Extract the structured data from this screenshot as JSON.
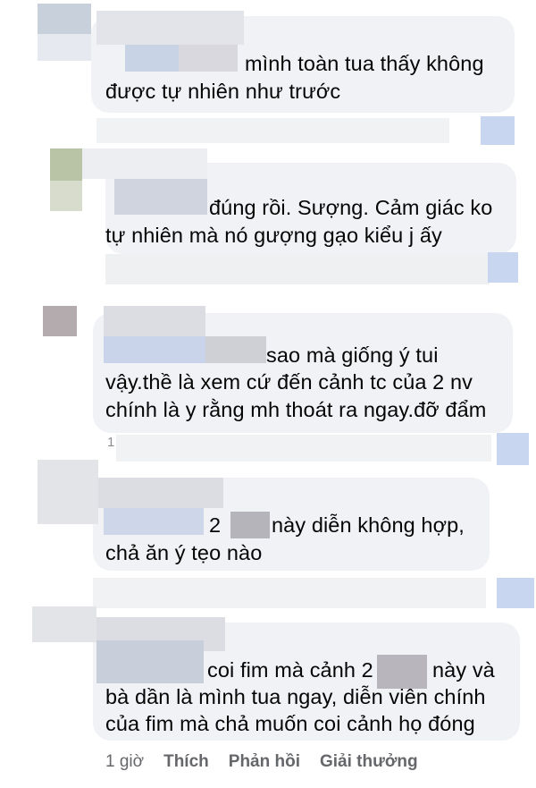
{
  "comments": [
    {
      "lines": [
        "mình toàn tua thấy không",
        "được tự nhiên như trước"
      ]
    },
    {
      "lines": [
        "đúng rồi. Sượng. Cảm giác ko",
        "tự nhiên mà nó gượng gạo kiểu j ấy"
      ]
    },
    {
      "lines": [
        "sao mà giống ý tui",
        "vậy.thề là xem cứ đến cảnh tc của 2 nv",
        "chính là y rằng mh thoát ra ngay.đỡ đẩm"
      ]
    },
    {
      "lines": [
        "2",
        "này diễn không hợp,",
        "chả ăn ý tẹo nào"
      ]
    },
    {
      "lines": [
        "coi fim mà cảnh 2",
        "này và",
        "bà dần là mình tua ngay, diễn viên chính",
        "của fim mà chả muốn coi cảnh họ đóng"
      ]
    }
  ],
  "partial_time": "1",
  "last_actions": {
    "time": "1 giờ",
    "like": "Thích",
    "reply": "Phản hồi",
    "award": "Giải thưởng"
  }
}
